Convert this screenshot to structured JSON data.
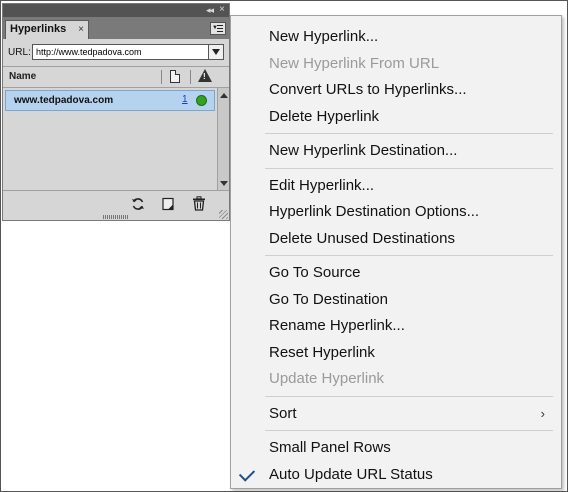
{
  "panel": {
    "title": "Hyperlinks",
    "tab_close": "×",
    "collapse_glyph": "◂◂",
    "close_glyph": "×",
    "url_label": "URL:",
    "url_value": "http://www.tedpadova.com",
    "column_name": "Name",
    "rows": [
      {
        "name": "www.tedpadova.com",
        "page": "1",
        "status": "ok"
      }
    ],
    "status_color": "#31a321",
    "selection_color": "#b5d2ee"
  },
  "menu": {
    "groups": [
      [
        {
          "label": "New Hyperlink...",
          "enabled": true
        },
        {
          "label": "New Hyperlink From URL",
          "enabled": false
        },
        {
          "label": "Convert URLs to Hyperlinks...",
          "enabled": true
        },
        {
          "label": "Delete Hyperlink",
          "enabled": true
        }
      ],
      [
        {
          "label": "New Hyperlink Destination...",
          "enabled": true
        }
      ],
      [
        {
          "label": "Edit Hyperlink...",
          "enabled": true
        },
        {
          "label": "Hyperlink Destination Options...",
          "enabled": true
        },
        {
          "label": "Delete Unused Destinations",
          "enabled": true
        }
      ],
      [
        {
          "label": "Go To Source",
          "enabled": true
        },
        {
          "label": "Go To Destination",
          "enabled": true
        },
        {
          "label": "Rename Hyperlink...",
          "enabled": true
        },
        {
          "label": "Reset Hyperlink",
          "enabled": true
        },
        {
          "label": "Update Hyperlink",
          "enabled": false
        }
      ],
      [
        {
          "label": "Sort",
          "enabled": true,
          "submenu": true
        }
      ],
      [
        {
          "label": "Small Panel Rows",
          "enabled": true
        },
        {
          "label": "Auto Update URL Status",
          "enabled": true,
          "checked": true
        }
      ]
    ],
    "submenu_glyph": "›"
  }
}
